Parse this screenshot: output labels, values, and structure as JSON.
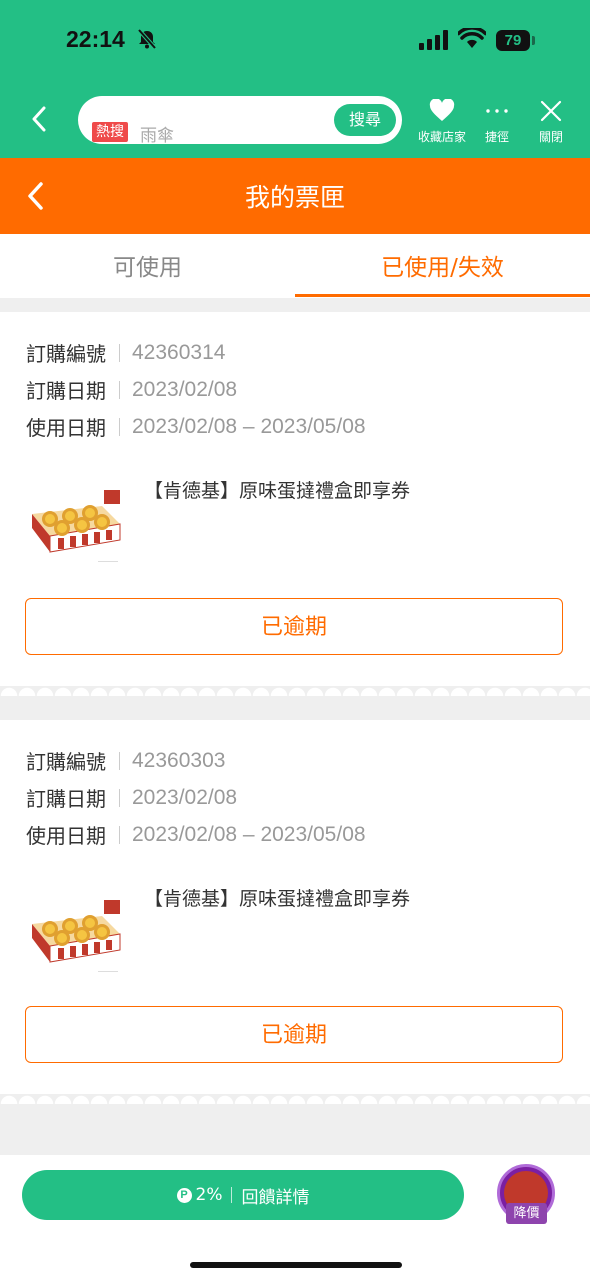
{
  "status_bar": {
    "time": "22:14",
    "battery": "79"
  },
  "search": {
    "hot_tag": "熱搜",
    "hot_keyword": "雨傘",
    "button": "搜尋"
  },
  "top_actions": {
    "favorite_label": "收藏店家",
    "shortcut_label": "捷徑",
    "close_label": "關閉"
  },
  "header": {
    "title": "我的票匣"
  },
  "tabs": {
    "available": "可使用",
    "used_expired": "已使用/失效"
  },
  "labels": {
    "order_no": "訂購編號",
    "order_date": "訂購日期",
    "use_date": "使用日期"
  },
  "tickets": [
    {
      "order_no": "42360314",
      "order_date": "2023/02/08",
      "use_date": "2023/02/08 – 2023/05/08",
      "product": "【肯德基】原味蛋撻禮盒即享券",
      "status": "已逾期"
    },
    {
      "order_no": "42360303",
      "order_date": "2023/02/08",
      "use_date": "2023/02/08 – 2023/05/08",
      "product": "【肯德基】原味蛋撻禮盒即享券",
      "status": "已逾期"
    }
  ],
  "bottom": {
    "reward_icon": "P",
    "reward_rate": "2%",
    "reward_label": "回饋詳情",
    "promo_tag": "降價"
  },
  "colors": {
    "green": "#23bf85",
    "orange": "#ff6b00"
  }
}
